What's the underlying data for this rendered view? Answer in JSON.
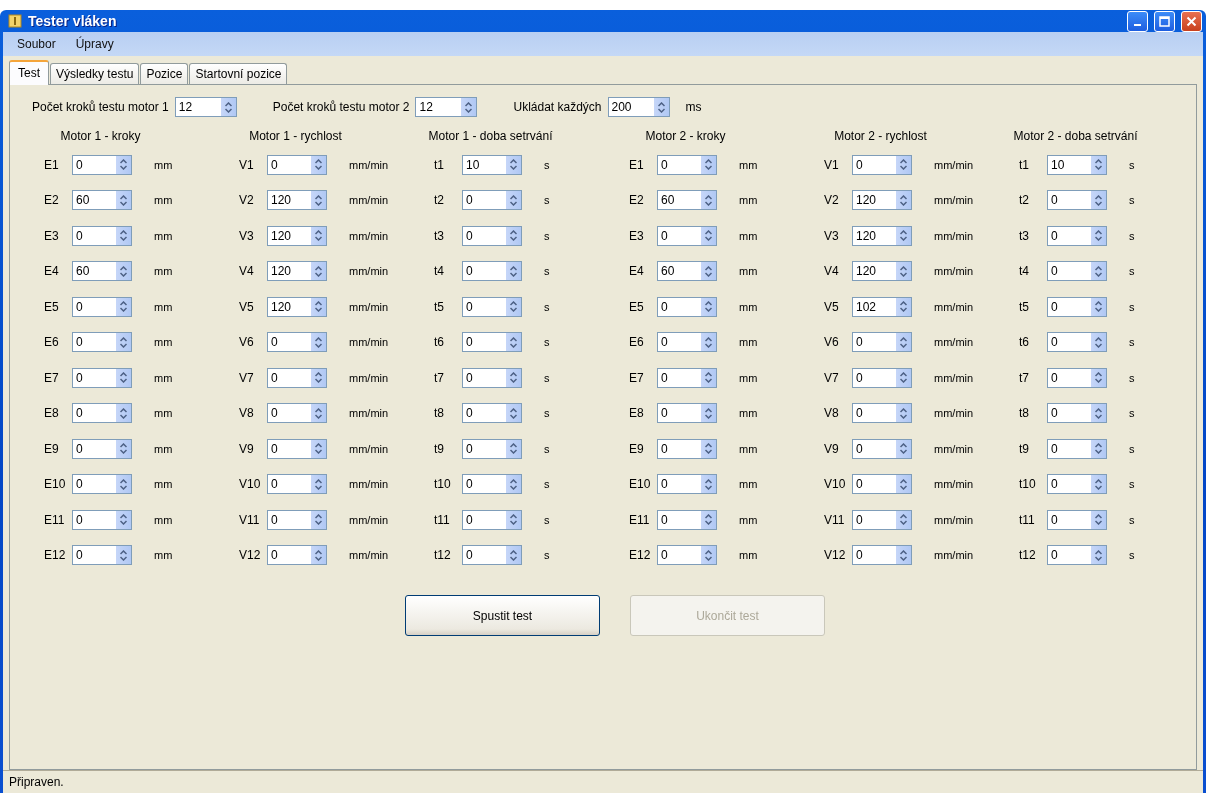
{
  "window": {
    "title": "Tester vláken"
  },
  "menu": [
    "Soubor",
    "Úpravy"
  ],
  "tabs": [
    {
      "label": "Test",
      "selected": true
    },
    {
      "label": "Výsledky testu",
      "selected": false
    },
    {
      "label": "Pozice",
      "selected": false
    },
    {
      "label": "Startovní pozice",
      "selected": false
    }
  ],
  "settings": [
    {
      "label": "Počet kroků testu motor 1",
      "value": "12"
    },
    {
      "label": "Počet kroků testu motor 2",
      "value": "12"
    },
    {
      "label": "Ukládat každých",
      "value": "200",
      "unit": "ms"
    }
  ],
  "groups": [
    {
      "heading": "Motor 1 - kroky",
      "rows": [
        {
          "label": "E1",
          "value": "0",
          "unit": "mm"
        },
        {
          "label": "E2",
          "value": "60",
          "unit": "mm"
        },
        {
          "label": "E3",
          "value": "0",
          "unit": "mm"
        },
        {
          "label": "E4",
          "value": "60",
          "unit": "mm"
        },
        {
          "label": "E5",
          "value": "0",
          "unit": "mm"
        },
        {
          "label": "E6",
          "value": "0",
          "unit": "mm"
        },
        {
          "label": "E7",
          "value": "0",
          "unit": "mm"
        },
        {
          "label": "E8",
          "value": "0",
          "unit": "mm"
        },
        {
          "label": "E9",
          "value": "0",
          "unit": "mm"
        },
        {
          "label": "E10",
          "value": "0",
          "unit": "mm"
        },
        {
          "label": "E11",
          "value": "0",
          "unit": "mm"
        },
        {
          "label": "E12",
          "value": "0",
          "unit": "mm"
        }
      ]
    },
    {
      "heading": "Motor 1 - rychlost",
      "rows": [
        {
          "label": "V1",
          "value": "0",
          "unit": "mm/min"
        },
        {
          "label": "V2",
          "value": "120",
          "unit": "mm/min"
        },
        {
          "label": "V3",
          "value": "120",
          "unit": "mm/min"
        },
        {
          "label": "V4",
          "value": "120",
          "unit": "mm/min"
        },
        {
          "label": "V5",
          "value": "120",
          "unit": "mm/min"
        },
        {
          "label": "V6",
          "value": "0",
          "unit": "mm/min"
        },
        {
          "label": "V7",
          "value": "0",
          "unit": "mm/min"
        },
        {
          "label": "V8",
          "value": "0",
          "unit": "mm/min"
        },
        {
          "label": "V9",
          "value": "0",
          "unit": "mm/min"
        },
        {
          "label": "V10",
          "value": "0",
          "unit": "mm/min"
        },
        {
          "label": "V11",
          "value": "0",
          "unit": "mm/min"
        },
        {
          "label": "V12",
          "value": "0",
          "unit": "mm/min"
        }
      ]
    },
    {
      "heading": "Motor 1 - doba setrvání",
      "rows": [
        {
          "label": "t1",
          "value": "10",
          "unit": "s"
        },
        {
          "label": "t2",
          "value": "0",
          "unit": "s"
        },
        {
          "label": "t3",
          "value": "0",
          "unit": "s"
        },
        {
          "label": "t4",
          "value": "0",
          "unit": "s"
        },
        {
          "label": "t5",
          "value": "0",
          "unit": "s"
        },
        {
          "label": "t6",
          "value": "0",
          "unit": "s"
        },
        {
          "label": "t7",
          "value": "0",
          "unit": "s"
        },
        {
          "label": "t8",
          "value": "0",
          "unit": "s"
        },
        {
          "label": "t9",
          "value": "0",
          "unit": "s"
        },
        {
          "label": "t10",
          "value": "0",
          "unit": "s"
        },
        {
          "label": "t11",
          "value": "0",
          "unit": "s"
        },
        {
          "label": "t12",
          "value": "0",
          "unit": "s"
        }
      ]
    },
    {
      "heading": "Motor 2 - kroky",
      "rows": [
        {
          "label": "E1",
          "value": "0",
          "unit": "mm"
        },
        {
          "label": "E2",
          "value": "60",
          "unit": "mm"
        },
        {
          "label": "E3",
          "value": "0",
          "unit": "mm"
        },
        {
          "label": "E4",
          "value": "60",
          "unit": "mm"
        },
        {
          "label": "E5",
          "value": "0",
          "unit": "mm"
        },
        {
          "label": "E6",
          "value": "0",
          "unit": "mm"
        },
        {
          "label": "E7",
          "value": "0",
          "unit": "mm"
        },
        {
          "label": "E8",
          "value": "0",
          "unit": "mm"
        },
        {
          "label": "E9",
          "value": "0",
          "unit": "mm"
        },
        {
          "label": "E10",
          "value": "0",
          "unit": "mm"
        },
        {
          "label": "E11",
          "value": "0",
          "unit": "mm"
        },
        {
          "label": "E12",
          "value": "0",
          "unit": "mm"
        }
      ]
    },
    {
      "heading": "Motor 2 - rychlost",
      "rows": [
        {
          "label": "V1",
          "value": "0",
          "unit": "mm/min"
        },
        {
          "label": "V2",
          "value": "120",
          "unit": "mm/min"
        },
        {
          "label": "V3",
          "value": "120",
          "unit": "mm/min"
        },
        {
          "label": "V4",
          "value": "120",
          "unit": "mm/min"
        },
        {
          "label": "V5",
          "value": "102",
          "unit": "mm/min"
        },
        {
          "label": "V6",
          "value": "0",
          "unit": "mm/min"
        },
        {
          "label": "V7",
          "value": "0",
          "unit": "mm/min"
        },
        {
          "label": "V8",
          "value": "0",
          "unit": "mm/min"
        },
        {
          "label": "V9",
          "value": "0",
          "unit": "mm/min"
        },
        {
          "label": "V10",
          "value": "0",
          "unit": "mm/min"
        },
        {
          "label": "V11",
          "value": "0",
          "unit": "mm/min"
        },
        {
          "label": "V12",
          "value": "0",
          "unit": "mm/min"
        }
      ]
    },
    {
      "heading": "Motor 2 - doba setrvání",
      "rows": [
        {
          "label": "t1",
          "value": "10",
          "unit": "s"
        },
        {
          "label": "t2",
          "value": "0",
          "unit": "s"
        },
        {
          "label": "t3",
          "value": "0",
          "unit": "s"
        },
        {
          "label": "t4",
          "value": "0",
          "unit": "s"
        },
        {
          "label": "t5",
          "value": "0",
          "unit": "s"
        },
        {
          "label": "t6",
          "value": "0",
          "unit": "s"
        },
        {
          "label": "t7",
          "value": "0",
          "unit": "s"
        },
        {
          "label": "t8",
          "value": "0",
          "unit": "s"
        },
        {
          "label": "t9",
          "value": "0",
          "unit": "s"
        },
        {
          "label": "t10",
          "value": "0",
          "unit": "s"
        },
        {
          "label": "t11",
          "value": "0",
          "unit": "s"
        },
        {
          "label": "t12",
          "value": "0",
          "unit": "s"
        }
      ]
    }
  ],
  "buttons": [
    {
      "label": "Spustit test",
      "disabled": false
    },
    {
      "label": "Ukončit test",
      "disabled": true
    }
  ],
  "status_bar": "Připraven."
}
